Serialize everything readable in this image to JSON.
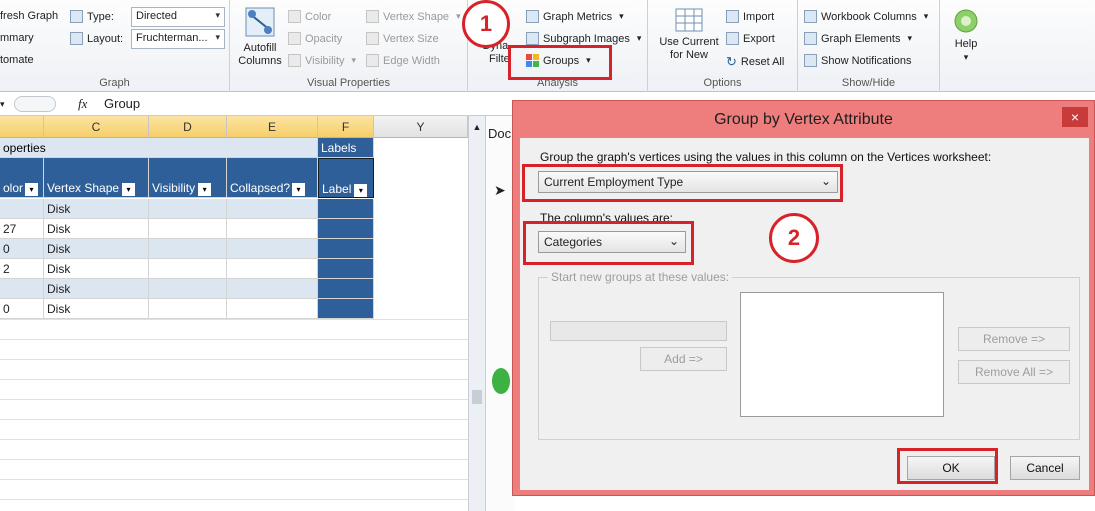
{
  "ribbon": {
    "graph": {
      "refresh": "fresh Graph",
      "summary": "mmary",
      "automate": "tomate",
      "type_label": "Type:",
      "type_value": "Directed",
      "layout_label": "Layout:",
      "layout_value": "Fruchterman...",
      "group_label": "Graph"
    },
    "visual": {
      "autofill": "Autofill Columns",
      "color": "Color",
      "opacity": "Opacity",
      "visibility": "Visibility",
      "vertex_shape": "Vertex Shape",
      "vertex_size": "Vertex Size",
      "edge_width": "Edge Width",
      "group_label": "Visual Properties"
    },
    "analysis": {
      "dynamic_filters": "Dynamic Filters",
      "graph_metrics": "Graph Metrics",
      "subgraph_images": "Subgraph Images",
      "groups": "Groups",
      "group_label": "Analysis"
    },
    "options": {
      "use_current": "Use Current for New",
      "import": "Import",
      "export": "Export",
      "reset_all": "Reset All",
      "group_label": "Options"
    },
    "showhide": {
      "workbook_columns": "Workbook Columns",
      "graph_elements": "Graph Elements",
      "show_notifications": "Show Notifications",
      "group_label": "Show/Hide"
    },
    "help": {
      "label": "Help"
    }
  },
  "formula_bar": {
    "fx": "fx",
    "value": "Group"
  },
  "sheet": {
    "columns": [
      "C",
      "D",
      "E",
      "F",
      "Y"
    ],
    "section_properties": "operties",
    "section_labels": "Labels",
    "headers": [
      "olor",
      "Vertex Shape",
      "Visibility",
      "Collapsed?",
      "Label"
    ],
    "rows": [
      [
        "",
        "Disk"
      ],
      [
        "27",
        "Disk"
      ],
      [
        "0",
        "Disk"
      ],
      [
        "2",
        "Disk"
      ],
      [
        "",
        "Disk"
      ],
      [
        "0",
        "Disk"
      ]
    ],
    "graph_pane_tab": "Doc"
  },
  "dialog": {
    "title": "Group by Vertex Attribute",
    "close": "×",
    "instruction": "Group the graph's vertices using the values in this column on the Vertices worksheet:",
    "column_value": "Current Employment Type",
    "values_are_label": "The column's values are:",
    "values_are_value": "Categories",
    "start_groups_label": "Start new groups at these values:",
    "add_button": "Add =>",
    "remove_button": "Remove =>",
    "remove_all_button": "Remove All =>",
    "ok_button": "OK",
    "cancel_button": "Cancel"
  },
  "annotations": {
    "step1": "1",
    "step2": "2"
  },
  "colors": {
    "accent_red": "#d8222a",
    "dialog_frame": "#ee7d7d",
    "header_blue": "#2f5f98"
  }
}
